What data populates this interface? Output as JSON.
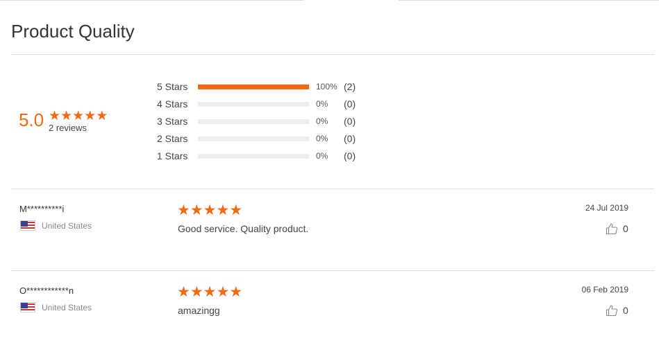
{
  "title": "Product Quality",
  "summary": {
    "average": "5.0",
    "rating_fraction": 1.0,
    "reviews_label": "2 reviews"
  },
  "histogram": [
    {
      "label": "5 Stars",
      "percent": "100%",
      "fraction": 1.0,
      "count": "(2)"
    },
    {
      "label": "4 Stars",
      "percent": "0%",
      "fraction": 0,
      "count": "(0)"
    },
    {
      "label": "3 Stars",
      "percent": "0%",
      "fraction": 0,
      "count": "(0)"
    },
    {
      "label": "2 Stars",
      "percent": "0%",
      "fraction": 0,
      "count": "(0)"
    },
    {
      "label": "1 Stars",
      "percent": "0%",
      "fraction": 0,
      "count": "(0)"
    }
  ],
  "reviews": [
    {
      "name": "M**********i",
      "country": "United States",
      "stars": 5,
      "text": "Good service.  Quality product.",
      "date": "24 Jul 2019",
      "likes": "0"
    },
    {
      "name": "O************n",
      "country": "United States",
      "stars": 5,
      "text": "amazingg",
      "date": "06 Feb 2019",
      "likes": "0"
    }
  ],
  "colors": {
    "accent": "#f06a13",
    "bar_empty": "#eeeeee"
  },
  "icons": {
    "star": "star-icon",
    "flag": "us-flag-icon",
    "like": "thumbs-up-icon"
  }
}
